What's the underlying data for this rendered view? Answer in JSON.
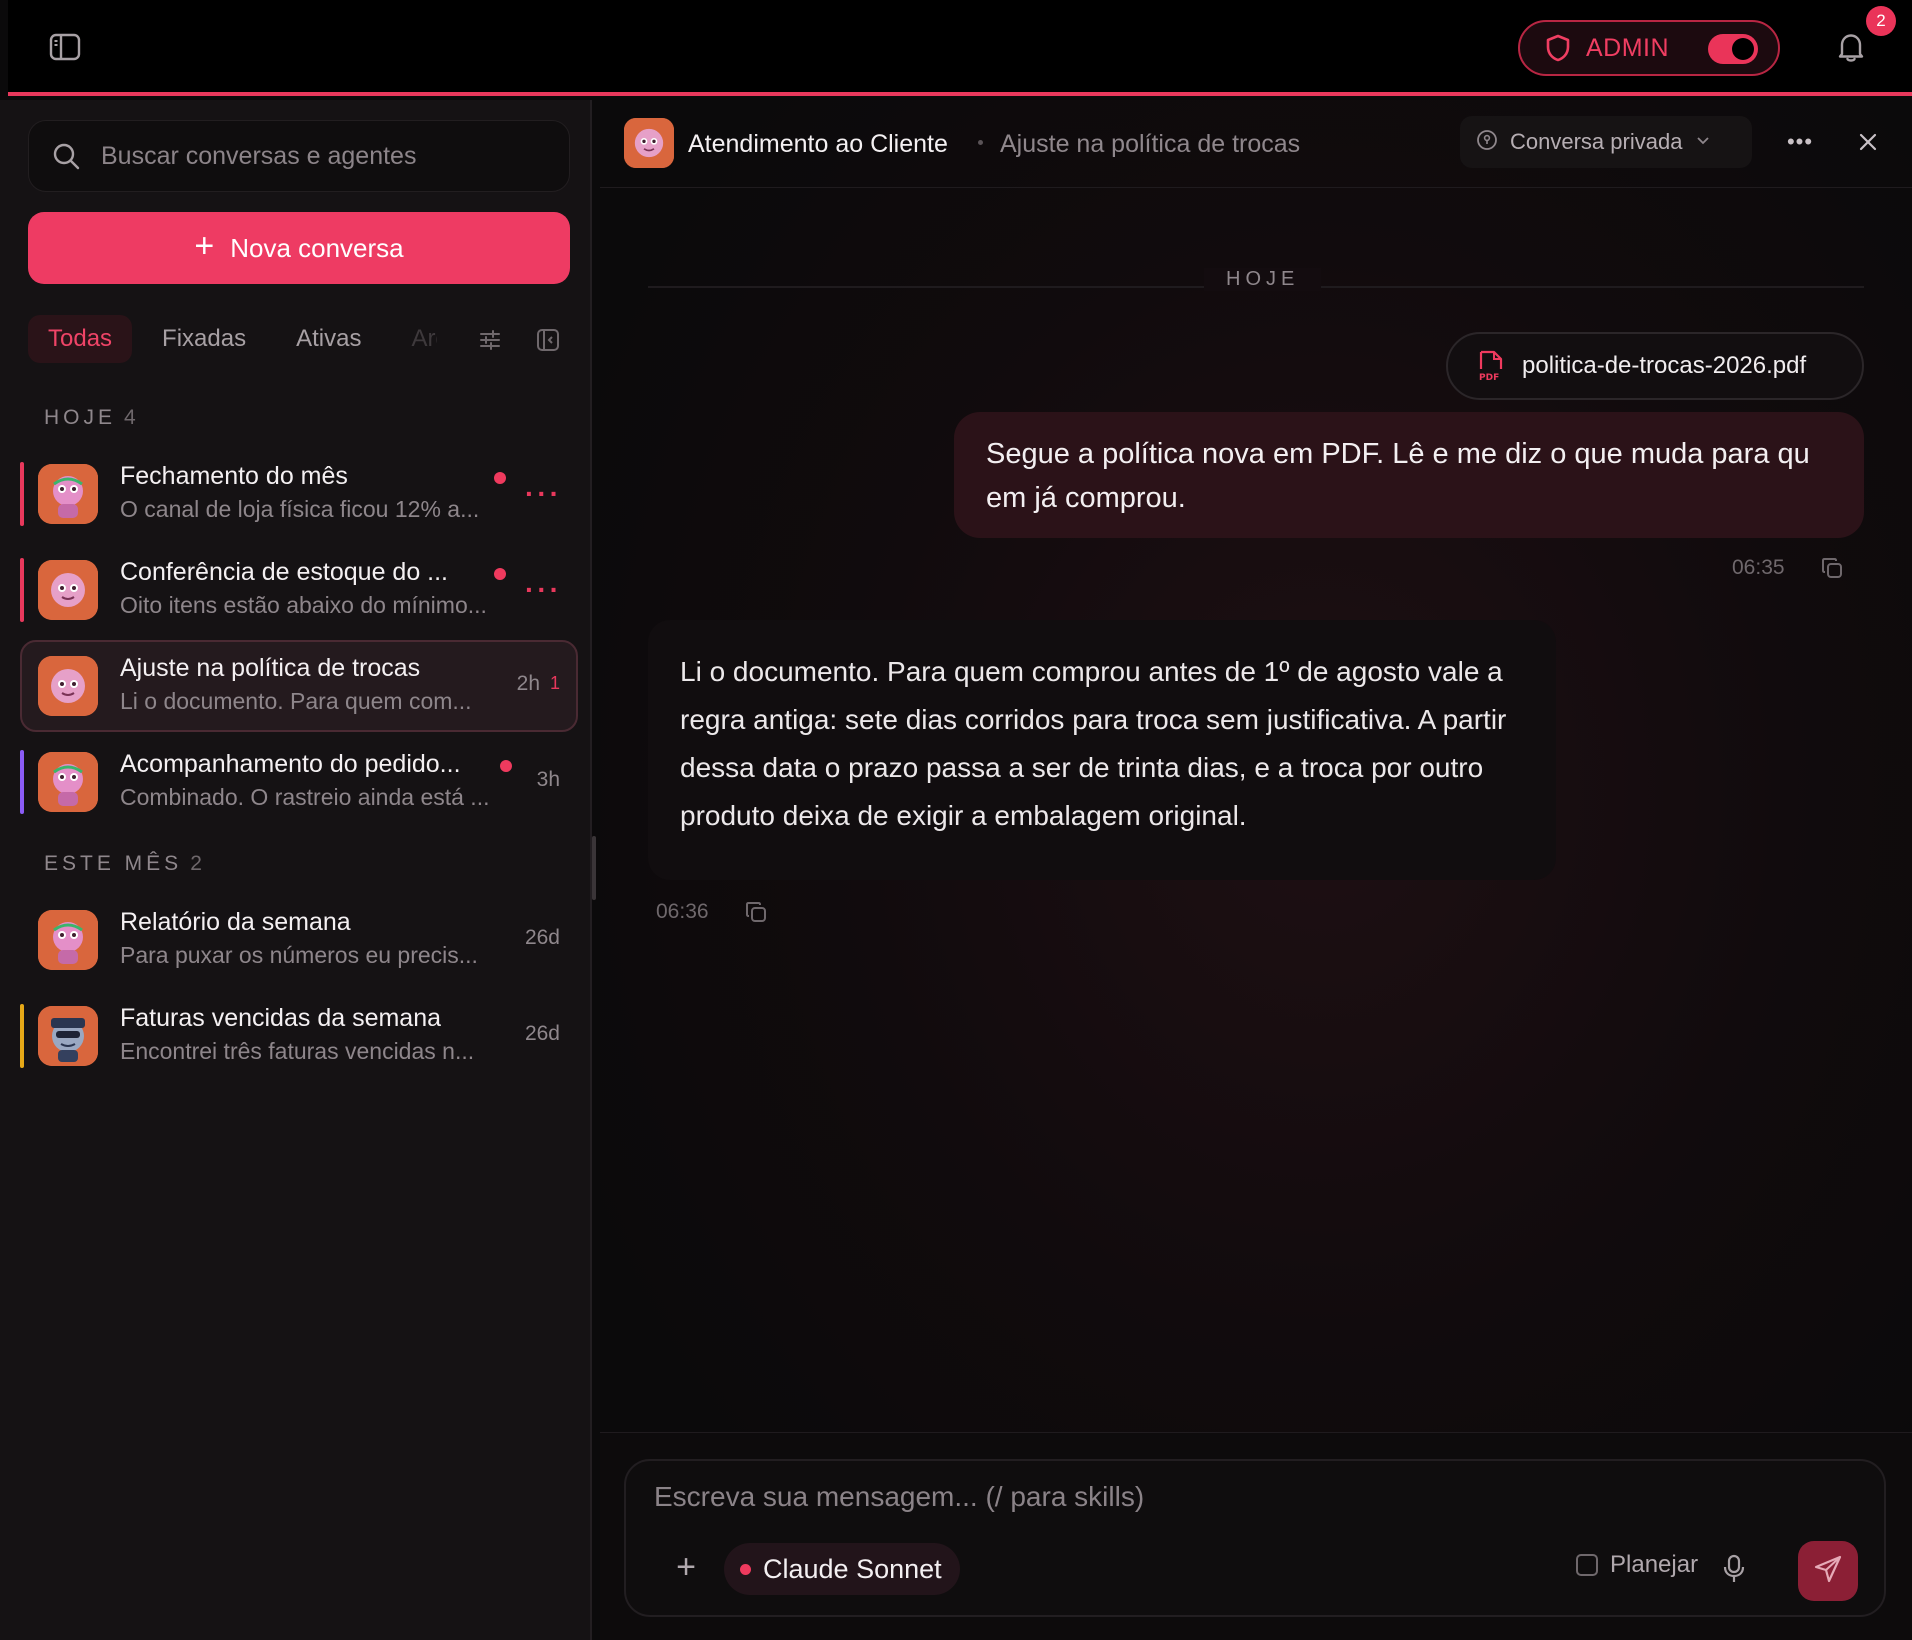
{
  "topbar": {
    "admin_label": "ADMIN",
    "admin_toggle_on": true,
    "notifications_count": "2"
  },
  "sidebar": {
    "search_placeholder": "Buscar conversas e agentes",
    "new_conversation_label": "Nova conversa",
    "filters": [
      "Todas",
      "Fixadas",
      "Ativas",
      "Arq"
    ],
    "active_filter": "Todas",
    "sections": [
      {
        "label": "HOJE",
        "count": "4",
        "items": [
          {
            "title": "Fechamento do mês",
            "preview": "O canal de loja física ficou 12% a...",
            "unread_dot": true,
            "accent": "#e8385c"
          },
          {
            "title": "Conferência de estoque do ...",
            "preview": "Oito itens estão abaixo do mínimo...",
            "unread_dot": true,
            "accent": "#e8385c"
          },
          {
            "title": "Ajuste na política de trocas",
            "preview": "Li o documento. Para quem com...",
            "time": "2h",
            "unread_count": "1",
            "selected": true
          },
          {
            "title": "Acompanhamento do pedido...",
            "preview": "Combinado. O rastreio ainda está ...",
            "time": "3h",
            "unread_dot": true,
            "accent": "#8b5cf6"
          }
        ]
      },
      {
        "label": "ESTE MÊS",
        "count": "2",
        "items": [
          {
            "title": "Relatório da semana",
            "preview": "Para puxar os números eu precis...",
            "time": "26d"
          },
          {
            "title": "Faturas vencidas da semana",
            "preview": "Encontrei três faturas vencidas n...",
            "time": "26d",
            "accent": "#e6a817"
          }
        ]
      }
    ]
  },
  "chat": {
    "agent_name": "Atendimento ao Cliente",
    "conversation_title": "Ajuste na política de trocas",
    "privacy_label": "Conversa privada",
    "day_label": "HOJE",
    "attachment_name": "politica-de-trocas-2026.pdf",
    "user_message": "Segue a política nova em PDF. Lê e me diz o que muda para qu em já comprou.",
    "user_time": "06:35",
    "bot_message": "Li o documento. Para quem comprou antes de 1º de agosto vale a regra antiga: sete dias corridos para troca sem justificativa. A partir dessa data o prazo passa a ser de trinta dias, e a troca por outro produto deixa de exigir a embalagem original.",
    "bot_time": "06:36"
  },
  "composer": {
    "placeholder": "Escreva sua mensagem... (/ para skills)",
    "model_label": "Claude Sonnet",
    "plan_label": "Planejar"
  },
  "colors": {
    "accent": "#ee3b63",
    "background": "#0b0a0b"
  }
}
